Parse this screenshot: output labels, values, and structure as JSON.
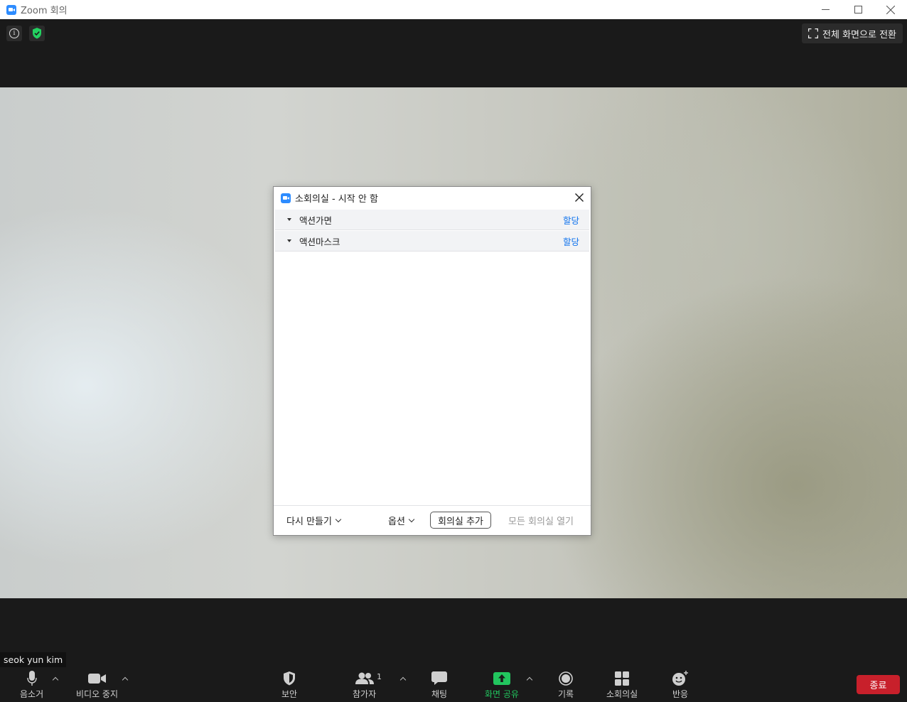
{
  "window": {
    "title": "Zoom 회의",
    "controls": [
      "minimize-icon",
      "maximize-icon",
      "close-icon"
    ]
  },
  "topbar": {
    "info_icon": "info-icon",
    "security_icon": "shield-check-icon",
    "fullscreen_label": "전체 화면으로 전환"
  },
  "dialog": {
    "title": "소회의실 - 시작 안 함",
    "rooms": [
      {
        "name": "액션가면",
        "action": "할당"
      },
      {
        "name": "액션마스크",
        "action": "할당"
      }
    ],
    "footer": {
      "recreate_label": "다시 만들기",
      "options_label": "옵션",
      "add_room_label": "회의실 추가",
      "open_all_label": "모든 회의실 열기"
    }
  },
  "participant_name": "seok yun kim",
  "toolbar": {
    "mute_label": "음소거",
    "video_label": "비디오 중지",
    "security_label": "보안",
    "participants_label": "참가자",
    "participants_count": "1",
    "chat_label": "채팅",
    "share_label": "화면 공유",
    "record_label": "기록",
    "breakout_label": "소회의실",
    "reactions_label": "반응",
    "end_label": "종료"
  },
  "colors": {
    "accent": "#2d8cff",
    "share_green": "#22c55e",
    "end_red": "#c8202b",
    "link_blue": "#0e72ed",
    "toolbar_bg": "#1a1a1a"
  }
}
